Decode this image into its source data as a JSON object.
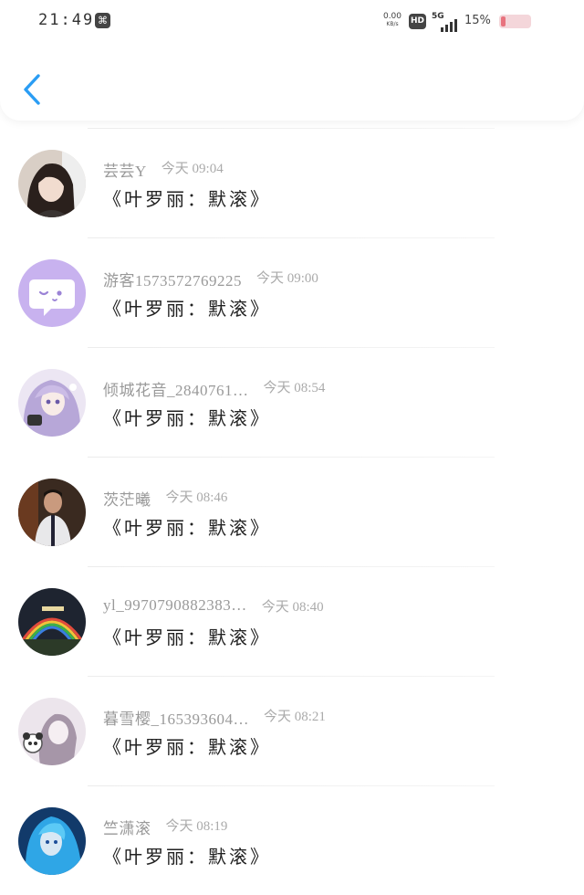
{
  "status_bar": {
    "time": "21:49",
    "app_icon_glyph": "⌘",
    "net_speed_value": "0.00",
    "net_speed_unit": "KB/s",
    "hd_label": "HD",
    "signal_label": "5G",
    "battery_percent": "15%",
    "battery_level": 0.15,
    "battery_color": "#e8737e"
  },
  "nav": {
    "back_icon": "chevron-left-icon",
    "accent_color": "#2a9df4"
  },
  "comments": [
    {
      "user": "芸芸Y",
      "time": "今天 09:04",
      "text": "《叶罗丽：默滚》",
      "avatar": "photo-girl"
    },
    {
      "user": "游客1573572769225",
      "time": "今天 09:00",
      "text": "《叶罗丽：默滚》",
      "avatar": "default-chat-bubble"
    },
    {
      "user": "倾城花音_2840761…",
      "time": "今天 08:54",
      "text": "《叶罗丽：默滚》",
      "avatar": "anime-girl-purple"
    },
    {
      "user": "茨茫曦",
      "time": "今天 08:46",
      "text": "《叶罗丽：默滚》",
      "avatar": "photo-man"
    },
    {
      "user": "yl_9970790882383…",
      "time": "今天 08:40",
      "text": "《叶罗丽：默滚》",
      "avatar": "rainbow-night"
    },
    {
      "user": "暮雪樱_165393604…",
      "time": "今天 08:21",
      "text": "《叶罗丽：默滚》",
      "avatar": "sketch-girl-panda"
    },
    {
      "user": "竺潇滚",
      "time": "今天 08:19",
      "text": "《叶罗丽：默滚》",
      "avatar": "anime-blue-hair"
    }
  ]
}
